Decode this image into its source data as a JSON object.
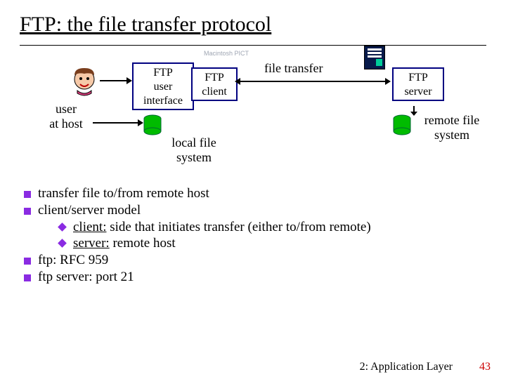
{
  "title": "FTP: the file transfer protocol",
  "diagram": {
    "watermark": "Macintosh PICT",
    "user_at_host_line1": "user",
    "user_at_host_line2": "at host",
    "ui_box_line1": "FTP",
    "ui_box_line2": "user",
    "ui_box_line3": "interface",
    "client_box_line1": "FTP",
    "client_box_line2": "client",
    "server_box_line1": "FTP",
    "server_box_line2": "server",
    "transfer_label": "file transfer",
    "local_fs_line1": "local file",
    "local_fs_line2": "system",
    "remote_fs_line1": "remote file",
    "remote_fs_line2": "system"
  },
  "bullets": {
    "b1": "transfer file to/from remote host",
    "b2": "client/server model",
    "b2a_term": "client:",
    "b2a_rest": " side that initiates transfer (either to/from remote)",
    "b2b_term": "server:",
    "b2b_rest": " remote host",
    "b3": "ftp: RFC 959",
    "b4": "ftp server: port 21"
  },
  "footer": {
    "chapter": "2: Application Layer",
    "page": "43"
  }
}
